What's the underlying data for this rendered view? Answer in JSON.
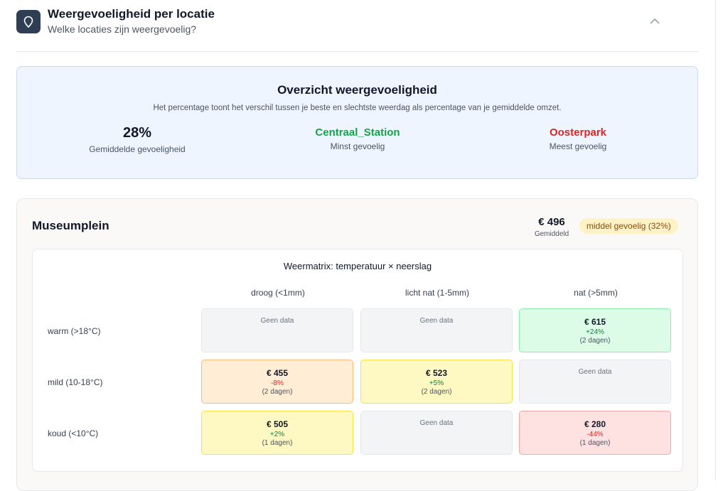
{
  "section": {
    "title": "Weergevoeligheid per locatie",
    "subtitle": "Welke locaties zijn weergevoelig?",
    "icon": "map-pin-icon",
    "collapse_icon": "chevron-up-icon"
  },
  "overview": {
    "title": "Overzicht weergevoeligheid",
    "description": "Het percentage toont het verschil tussen je beste en slechtste weerdag als percentage van je gemiddelde omzet.",
    "avg_value": "28%",
    "avg_label": "Gemiddelde gevoeligheid",
    "least_value": "Centraal_Station",
    "least_label": "Minst gevoelig",
    "most_value": "Oosterpark",
    "most_label": "Meest gevoelig"
  },
  "location": {
    "name": "Museumplein",
    "avg_value": "€ 496",
    "avg_label": "Gemiddeld",
    "badge": "middel gevoelig (32%)"
  },
  "matrix": {
    "title": "Weermatrix: temperatuur × neerslag",
    "columns": [
      "droog (<1mm)",
      "licht nat (1-5mm)",
      "nat (>5mm)"
    ],
    "rows": [
      "warm (>18°C)",
      "mild (10-18°C)",
      "koud (<10°C)"
    ],
    "cells": [
      [
        {
          "text": "Geen data"
        },
        {
          "text": "Geen data"
        },
        {
          "amount": "€ 615",
          "pct": "+24%",
          "days": "(2 dagen)"
        }
      ],
      [
        {
          "amount": "€ 455",
          "pct": "-8%",
          "days": "(2 dagen)"
        },
        {
          "amount": "€ 523",
          "pct": "+5%",
          "days": "(2 dagen)"
        },
        {
          "text": "Geen data"
        }
      ],
      [
        {
          "amount": "€ 505",
          "pct": "+2%",
          "days": "(1 dagen)"
        },
        {
          "text": "Geen data"
        },
        {
          "amount": "€ 280",
          "pct": "-44%",
          "days": "(1 dagen)"
        }
      ]
    ]
  },
  "colors": {
    "positive": "#15803d",
    "negative": "#dc2626",
    "badge_bg": "#fef3c7",
    "header_icon_bg": "#2f3e53"
  }
}
